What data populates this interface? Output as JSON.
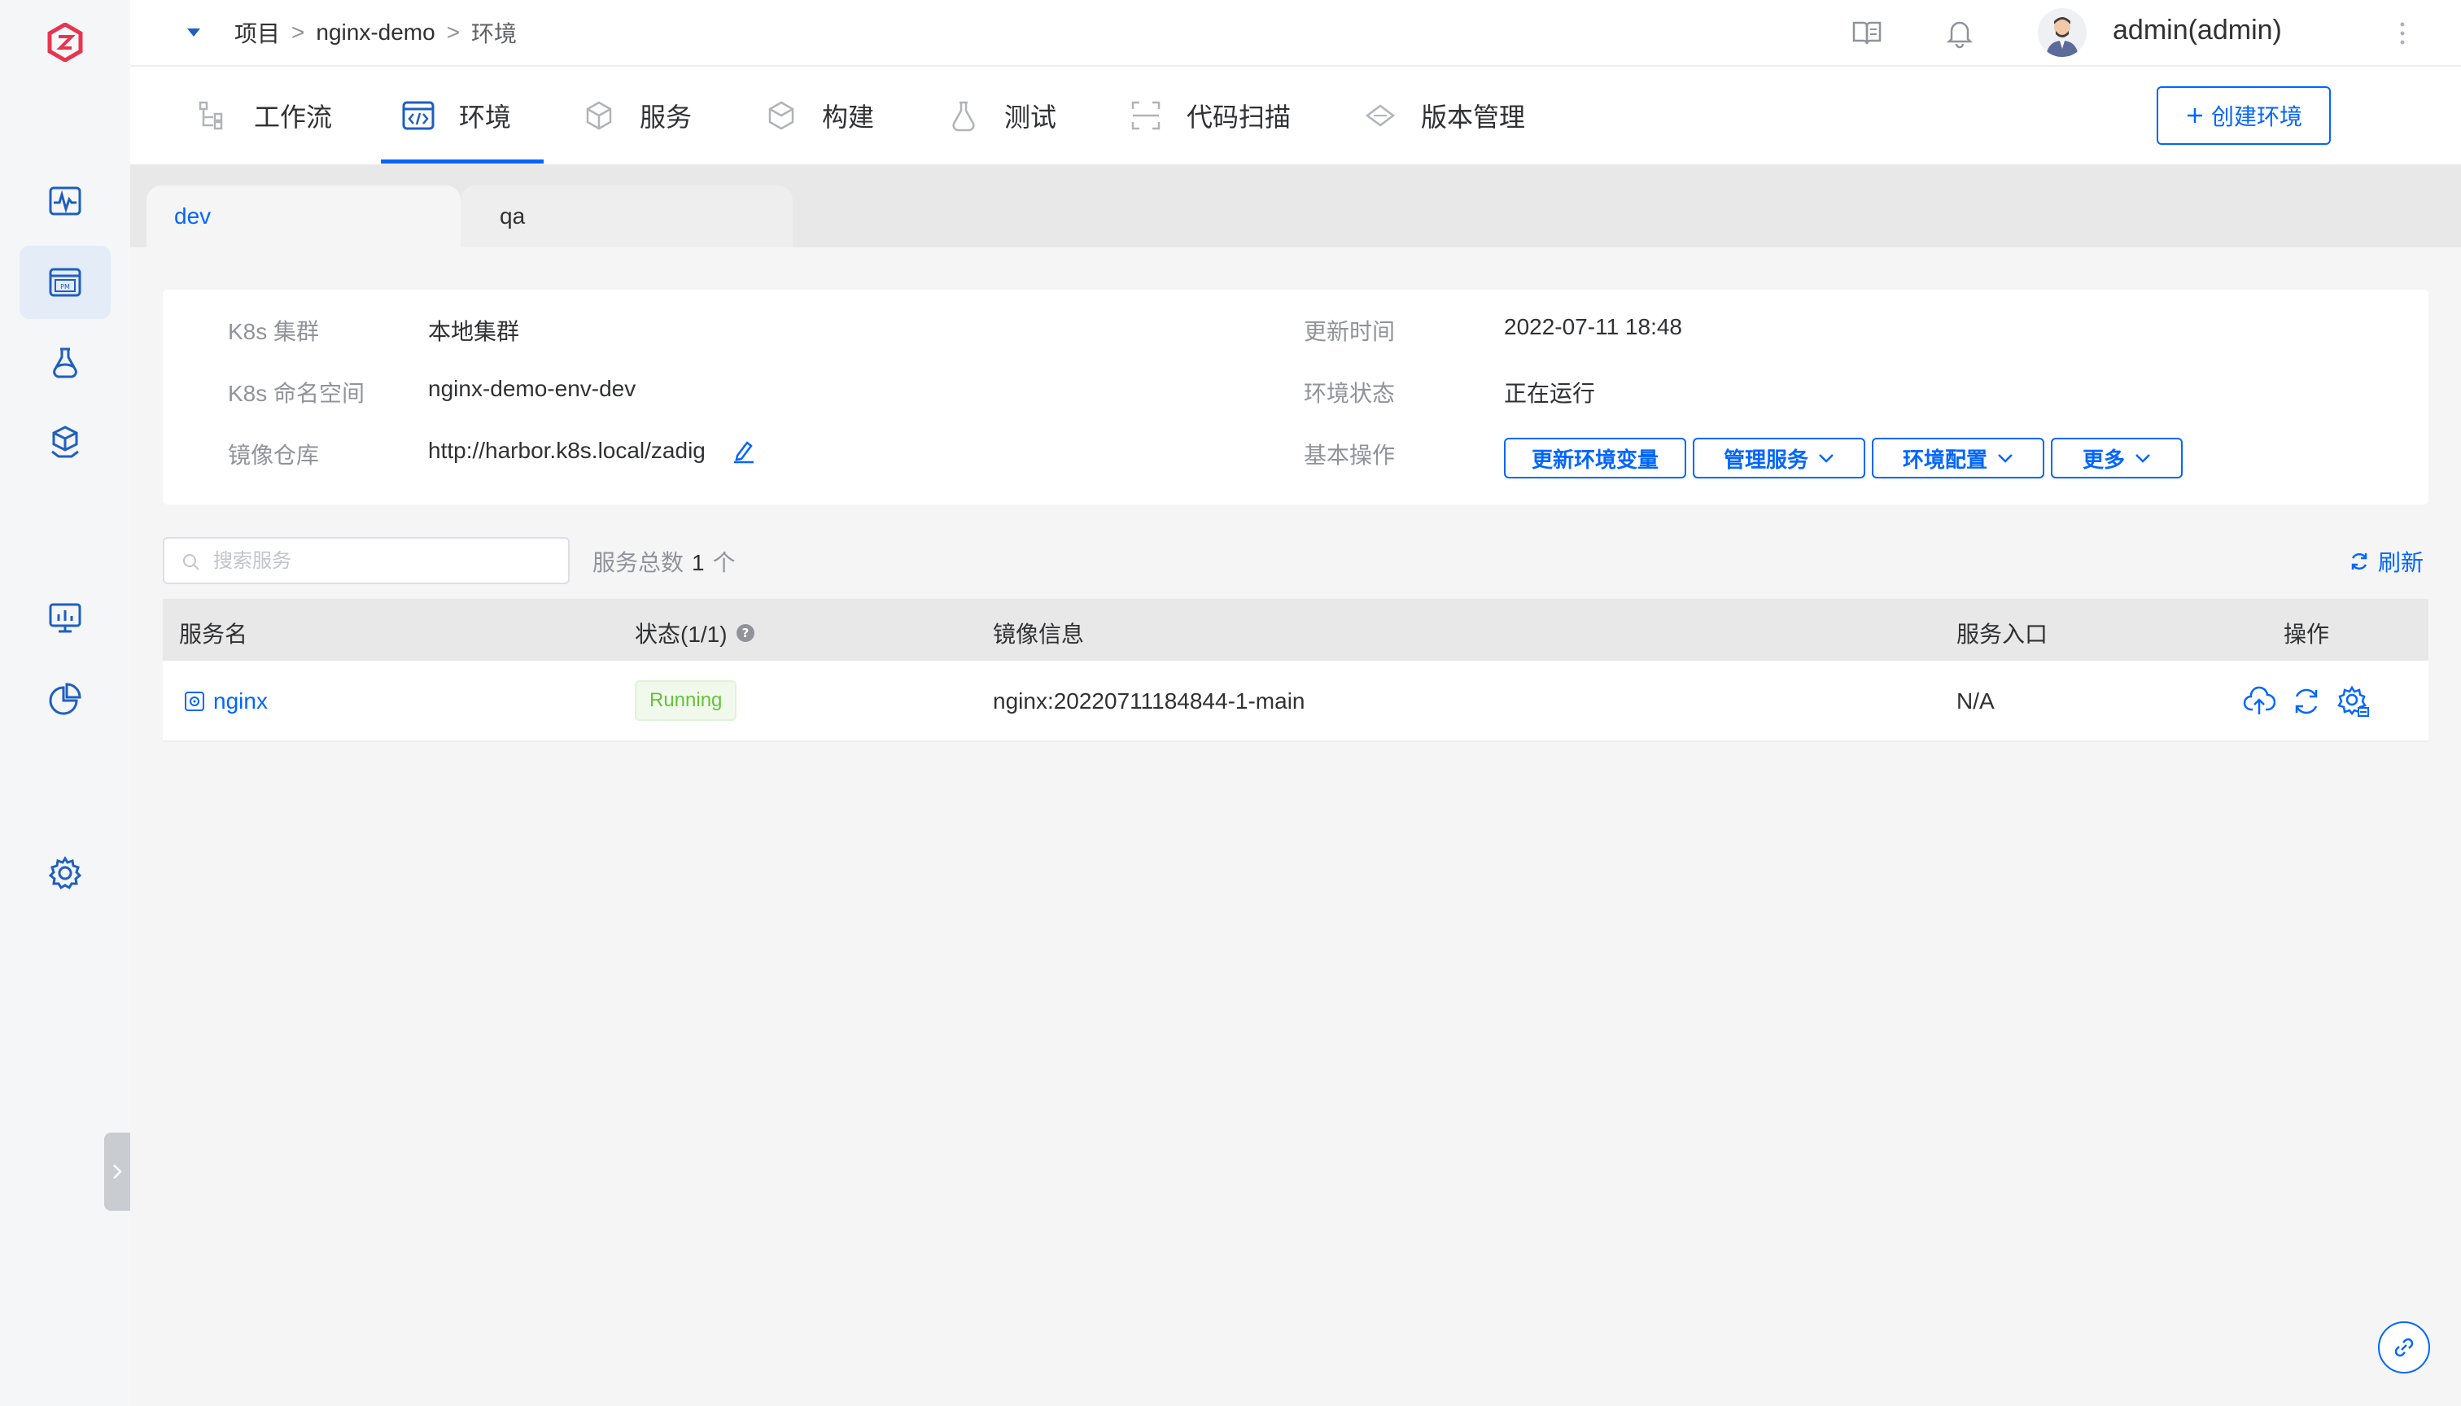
{
  "breadcrumb": {
    "root": "项目",
    "project": "nginx-demo",
    "current": "环境",
    "sep1": ">",
    "sep2": ">"
  },
  "user": {
    "name": "admin(admin)"
  },
  "nav": {
    "tabs": [
      {
        "label": "工作流",
        "icon": "workflow-icon"
      },
      {
        "label": "环境",
        "icon": "environment-code-icon",
        "active": true
      },
      {
        "label": "服务",
        "icon": "service-cube-icon"
      },
      {
        "label": "构建",
        "icon": "build-box-icon"
      },
      {
        "label": "测试",
        "icon": "test-flask-icon"
      },
      {
        "label": "代码扫描",
        "icon": "scan-frame-icon"
      },
      {
        "label": "版本管理",
        "icon": "version-diamond-icon"
      }
    ],
    "create_label": "创建环境"
  },
  "env_tabs": [
    {
      "label": "dev",
      "active": true
    },
    {
      "label": "qa",
      "active": false
    }
  ],
  "info": {
    "cluster_label": "K8s 集群",
    "cluster_value": "本地集群",
    "namespace_label": "K8s 命名空间",
    "namespace_value": "nginx-demo-env-dev",
    "registry_label": "镜像仓库",
    "registry_value": "http://harbor.k8s.local/zadig",
    "updated_label": "更新时间",
    "updated_value": "2022-07-11 18:48",
    "status_label": "环境状态",
    "status_value": "正在运行",
    "ops_label": "基本操作",
    "ops": {
      "update_vars": "更新环境变量",
      "manage_services": "管理服务",
      "env_config": "环境配置",
      "more": "更多"
    }
  },
  "toolbar": {
    "search_placeholder": "搜索服务",
    "count_label": "服务总数",
    "count_value": "1",
    "count_unit": "个",
    "refresh_label": "刷新"
  },
  "table": {
    "headers": {
      "name": "服务名",
      "status": "状态(1/1)",
      "image": "镜像信息",
      "entry": "服务入口",
      "actions": "操作"
    },
    "rows": [
      {
        "name": "nginx",
        "status": "Running",
        "image": "nginx:20220711184844-1-main",
        "entry": "N/A"
      }
    ]
  },
  "colors": {
    "accent": "#0066ff",
    "running": "#67c23a",
    "brand": "#e8344e"
  }
}
